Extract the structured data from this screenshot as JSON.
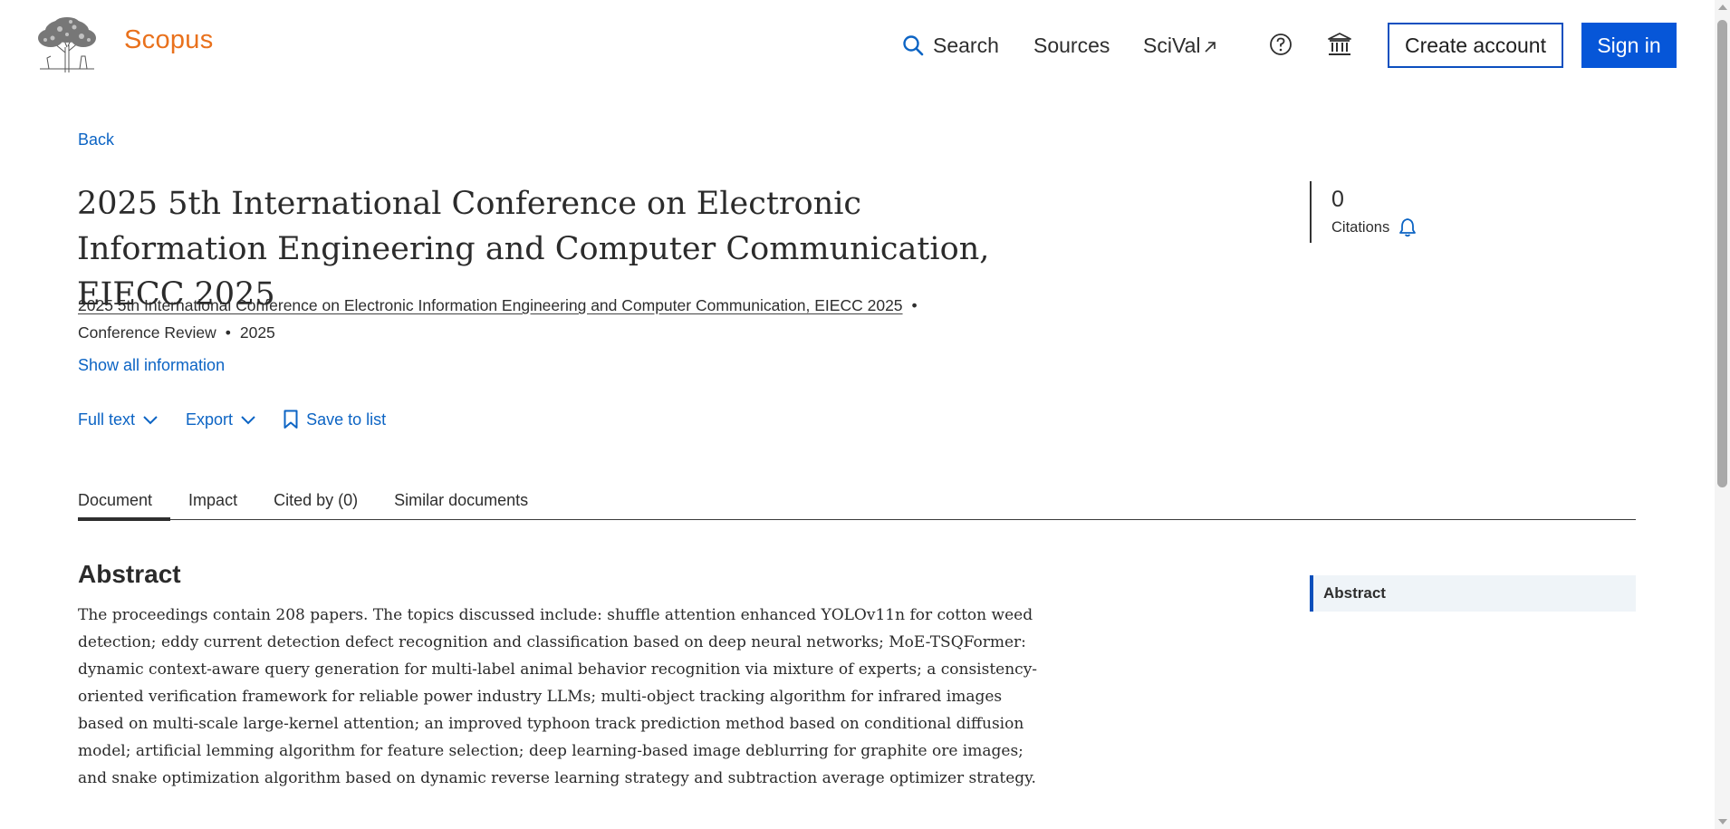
{
  "header": {
    "brand": "Scopus",
    "nav": {
      "search_label": "Search",
      "sources_label": "Sources",
      "scival_label": "SciVal"
    },
    "help_icon": "help-circle-icon",
    "institution_icon": "institution-icon",
    "create_account_label": "Create account",
    "sign_in_label": "Sign in"
  },
  "document": {
    "back_label": "Back",
    "title": "2025 5th International Conference on Electronic Information Engineering and Computer Communication, EIECC 2025",
    "source_title": "2025 5th International Conference on Electronic Information Engineering and Computer Communication, EIECC 2025",
    "document_type": "Conference Review",
    "year": "2025",
    "show_all_label": "Show all information",
    "actions": {
      "full_text_label": "Full text",
      "export_label": "Export",
      "save_label": "Save to list"
    }
  },
  "citations": {
    "count": "0",
    "label": "Citations"
  },
  "tabs": [
    {
      "label": "Document",
      "active": true
    },
    {
      "label": "Impact",
      "active": false
    },
    {
      "label": "Cited by (0)",
      "active": false
    },
    {
      "label": "Similar documents",
      "active": false
    }
  ],
  "abstract": {
    "heading": "Abstract",
    "text": "The proceedings contain 208 papers. The topics discussed include: shuffle attention enhanced YOLOv11n for cotton weed detection; eddy current detection defect recognition and classification based on deep neural networks; MoE-TSQFormer: dynamic context-aware query generation for multi-label animal behavior recognition via mixture of experts; a consistency-oriented verification framework for reliable power industry LLMs; multi-object tracking algorithm for infrared images based on multi-scale large-kernel attention; an improved typhoon track prediction method based on conditional diffusion model; artificial lemming algorithm for feature selection; deep learning-based image deblurring for graphite ore images; and snake optimization algorithm based on dynamic reverse learning strategy and subtraction average optimizer strategy."
  },
  "outline": {
    "abstract_label": "Abstract"
  },
  "colors": {
    "brand_orange": "#e9711c",
    "link_blue": "#0c64c4",
    "primary_button": "#0656d8"
  }
}
